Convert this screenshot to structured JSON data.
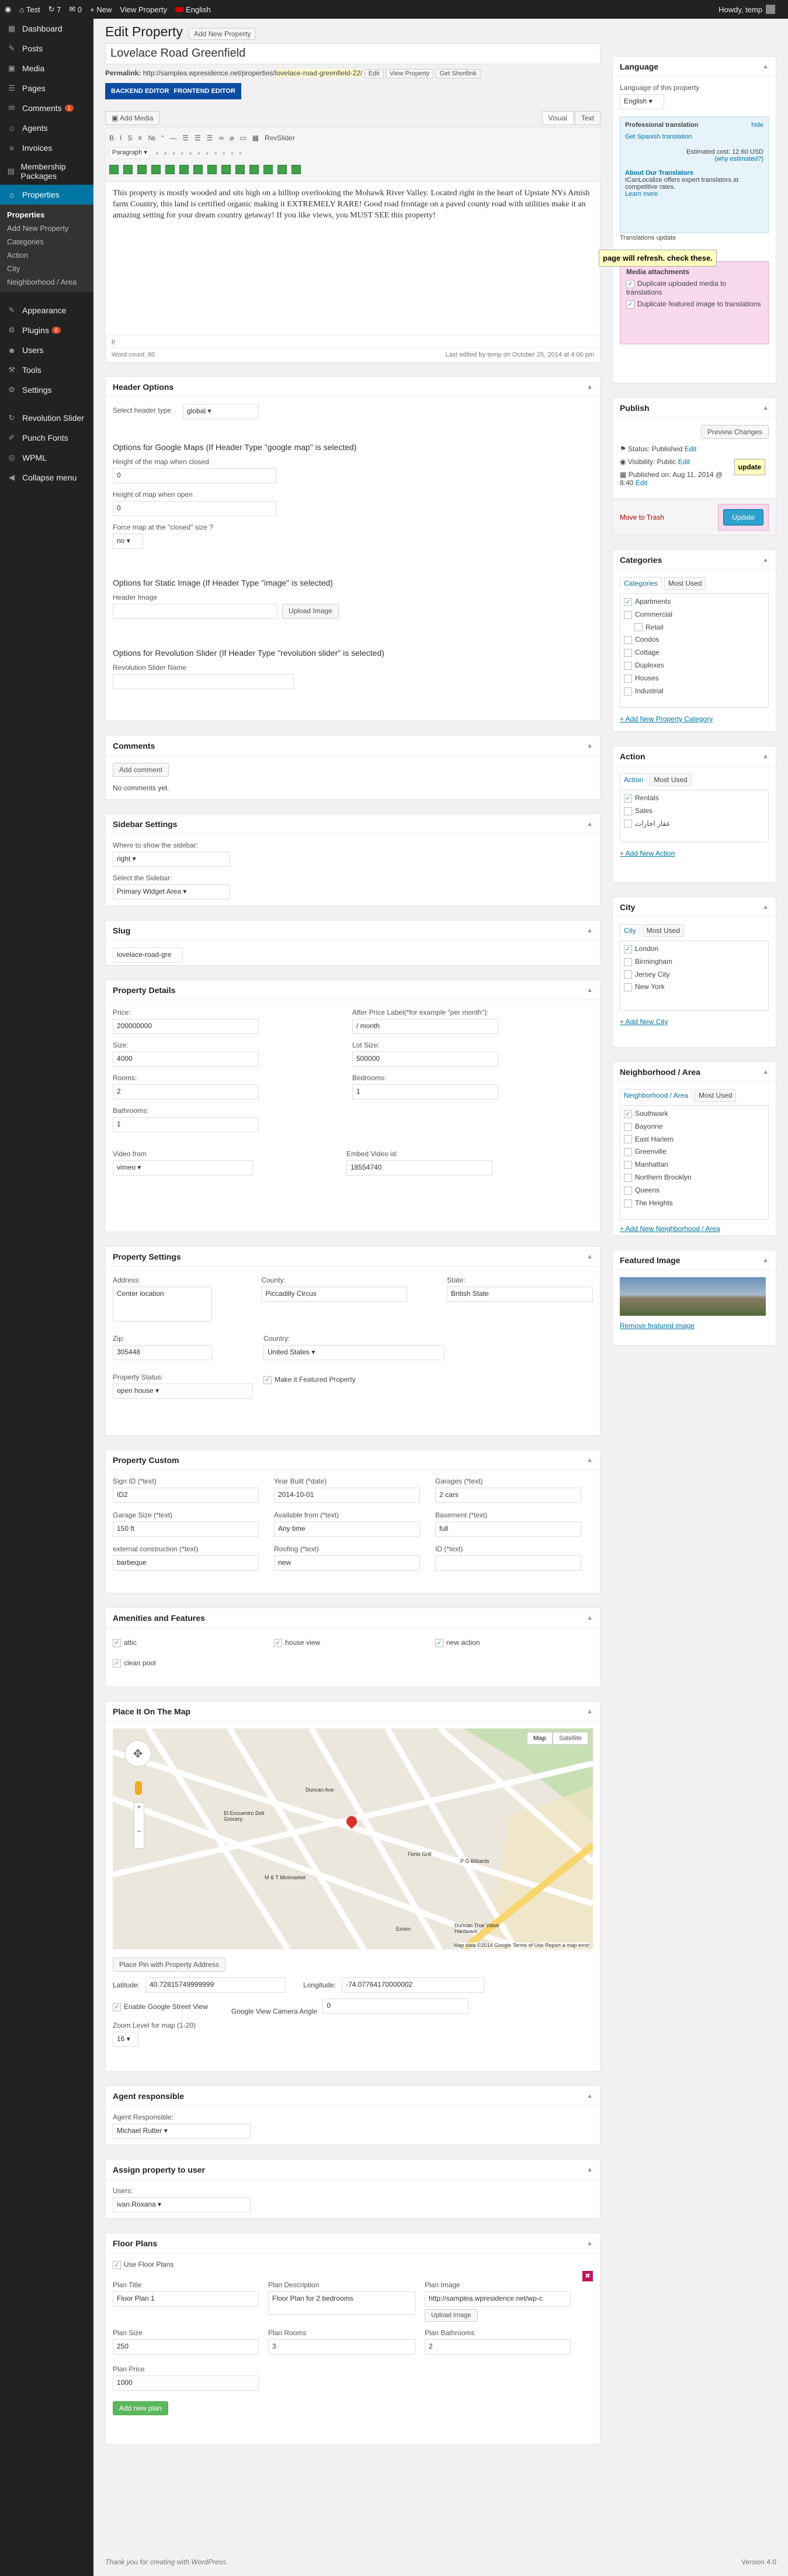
{
  "adminbar": {
    "site": "Test",
    "updates": "7",
    "comments": "0",
    "new": "New",
    "view": "View Property",
    "lang": "English",
    "howdy": "Howdy, temp"
  },
  "sidebar": {
    "items": [
      {
        "label": "Dashboard",
        "icon": "dashboard-icon"
      },
      {
        "label": "Posts",
        "icon": "pin-icon"
      },
      {
        "label": "Media",
        "icon": "media-icon"
      },
      {
        "label": "Pages",
        "icon": "page-icon"
      },
      {
        "label": "Comments",
        "icon": "comment-icon",
        "badge": "1"
      },
      {
        "label": "Agents",
        "icon": "agents-icon"
      },
      {
        "label": "Invoices",
        "icon": "invoice-icon"
      },
      {
        "label": "Membership Packages",
        "icon": "package-icon"
      },
      {
        "label": "Properties",
        "icon": "properties-icon",
        "active": true
      }
    ],
    "submenu": [
      "Properties",
      "Add New Property",
      "Categories",
      "Action",
      "City",
      "Neighborhood / Area"
    ],
    "items2": [
      {
        "label": "Appearance",
        "icon": "brush-icon"
      },
      {
        "label": "Plugins",
        "icon": "plugin-icon",
        "badge": "6"
      },
      {
        "label": "Users",
        "icon": "users-icon"
      },
      {
        "label": "Tools",
        "icon": "tools-icon"
      },
      {
        "label": "Settings",
        "icon": "settings-icon"
      }
    ],
    "items3": [
      {
        "label": "Revolution Slider",
        "icon": "slider-icon"
      },
      {
        "label": "Punch Fonts",
        "icon": "fonts-icon"
      },
      {
        "label": "WPML",
        "icon": "wpml-icon"
      },
      {
        "label": "Collapse menu",
        "icon": "collapse-icon"
      }
    ]
  },
  "header": {
    "title": "Edit Property",
    "add_new": "Add New Property"
  },
  "post": {
    "title": "Lovelace Road Greenfield",
    "permalink_label": "Permalink:",
    "permalink_base": "http://samplea.wpresidence.net/properties/",
    "permalink_slug": "lovelace-road-greenfield-22/",
    "edit": "Edit",
    "view": "View Property",
    "shortlink": "Get Shortlink",
    "backend_editor": "BACKEND EDITOR",
    "frontend_editor": "FRONTEND EDITOR",
    "add_media": "Add Media",
    "visual": "Visual",
    "text": "Text",
    "format": "Paragraph",
    "revslider": "RevSlider",
    "content": "This property is mostly wooded and sits high on a hilltop overlooking the Mohawk River Valley. Located right in the heart of Upstate NYs Amish farm Country, this land is certified organic making it EXTREMELY RARE! Good road frontage on a paved county road with utilities make it an amazing setting for your dream country getaway! If you like views, you MUST SEE this property!",
    "path": "p",
    "word_count": "Word count: 80",
    "last_edited": "Last edited by temp on October 25, 2014 at 4:00 pm"
  },
  "header_options": {
    "title": "Header Options",
    "type_label": "Select header type",
    "type_value": "global",
    "gmaps_title": "Options for Google Maps (If Header Type \"google map\" is selected)",
    "closed_label": "Height of the map when closed",
    "closed_value": "0",
    "open_label": "Height of map when open",
    "open_value": "0",
    "force_label": "Force map at the \"closed\" size ?",
    "force_value": "no",
    "image_title": "Options for Static Image (If Header Type \"image\" is selected)",
    "image_label": "Header Image",
    "upload": "Upload Image",
    "rev_title": "Options for Revolution Slider (If Header Type \"revolution slider\" is selected)",
    "rev_label": "Revolution Slider Name"
  },
  "comments": {
    "title": "Comments",
    "add": "Add comment",
    "none": "No comments yet."
  },
  "sidebar_settings": {
    "title": "Sidebar Settings",
    "where_label": "Where to show the sidebar:",
    "where_value": "right",
    "select_label": "Select the Sidebar:",
    "select_value": "Primary Widget Area"
  },
  "slug": {
    "title": "Slug",
    "value": "lovelace-road-gre"
  },
  "details": {
    "title": "Property Details",
    "price_label": "Price:",
    "price": "200000000",
    "after_label": "After Price Label(*for example \"per month\"):",
    "after": "/ month",
    "size_label": "Size:",
    "size": "4000",
    "lot_label": "Lot Size:",
    "lot": "500000",
    "rooms_label": "Rooms:",
    "rooms": "2",
    "bed_label": "Bedrooms:",
    "bed": "1",
    "bath_label": "Bathrooms:",
    "bath": "1",
    "video_label": "Video from",
    "video": "vimeo",
    "embed_label": "Embed Video id:",
    "embed": "18554740"
  },
  "settings": {
    "title": "Property Settings",
    "addr_label": "Address:",
    "addr": "Center location",
    "county_label": "County:",
    "county": "Piccadilly Circus",
    "state_label": "State:",
    "state": "British State",
    "zip_label": "Zip:",
    "zip": "305448",
    "country_label": "Country:",
    "country": "United States",
    "status_label": "Property Status:",
    "status": "open house",
    "featured": "Make it Featured Property"
  },
  "custom": {
    "title": "Property Custom",
    "fields": [
      {
        "label": "Sign ID (*text)",
        "value": "ID2"
      },
      {
        "label": "Year Built (*date)",
        "value": "2014-10-01"
      },
      {
        "label": "Garages (*text)",
        "value": "2 cars"
      },
      {
        "label": "Garage Size (*text)",
        "value": "150 ft"
      },
      {
        "label": "Available from (*text)",
        "value": "Any time"
      },
      {
        "label": "Basement (*text)",
        "value": "full"
      },
      {
        "label": "external construction (*text)",
        "value": "barbeque"
      },
      {
        "label": "Roofing (*text)",
        "value": "new"
      },
      {
        "label": "ID (*text)",
        "value": ""
      }
    ]
  },
  "amenities": {
    "title": "Amenities and Features",
    "items": [
      "attic",
      "house view",
      "new action",
      "clean pool"
    ]
  },
  "map": {
    "title": "Place It On The Map",
    "map_btn": "Map",
    "sat_btn": "Satellite",
    "place_btn": "Place Pin with Property Address",
    "lat_label": "Latitude:",
    "lat": "40.72815749999999",
    "lng_label": "Longitude:",
    "lng": "-74.07764170000002",
    "streetview": "Enable Google Street View",
    "angle_label": "Google View Camera Angle",
    "angle": "0",
    "zoom_label": "Zoom Level for map (1-20)",
    "zoom": "16",
    "credit": "Map data ©2014 Google   Terms of Use   Report a map error",
    "labels": [
      "El Encuentro Deli Grocery",
      "Fenix Grill",
      "P G Billiards",
      "M & T Minimarket",
      "Essen",
      "Duncan Ave",
      "Duncan True Value Hardware"
    ]
  },
  "agent": {
    "title": "Agent responsible",
    "label": "Agent Responsible:",
    "value": "Michael Rutter"
  },
  "assign": {
    "title": "Assign property to user",
    "label": "Users:",
    "value": "ivan.Roxana"
  },
  "floor": {
    "title": "Floor Plans",
    "use": "Use Floor Plans",
    "plan_title_label": "Plan Title",
    "plan_title": "Floor Plan 1",
    "desc_label": "Plan Description",
    "desc": "Floor Plan for 2 bedrooms",
    "image_label": "Plan Image",
    "image": "http://samplea.wpresidence.net/wp-c",
    "upload": "Upload Image",
    "size_label": "Plan Size",
    "size": "250",
    "rooms_label": "Plan Rooms",
    "rooms": "3",
    "bath_label": "Plan Bathrooms",
    "bath": "2",
    "price_label": "Plan Price",
    "price": "1000",
    "add": "Add new plan"
  },
  "footer": {
    "thanks": "Thank you for creating with WordPress.",
    "version": "Version 4.0"
  },
  "language": {
    "title": "Language",
    "label": "Language of this property",
    "value": "English",
    "pro_title": "Professional translation",
    "hide": "hide",
    "get_link": "Get Spanish translation",
    "cost": "Estimated cost: 12.60 USD",
    "why": "(why estimated?)",
    "about_title": "About Our Translators",
    "about_text": "ICanLocalize offers expert translators at competitive rates.",
    "learn": "Learn more",
    "tip": "page will refresh. check these.",
    "media_title": "Media attachments",
    "media1": "Duplicate uploaded media to translations",
    "media2": "Duplicate featured image to translations",
    "trans_update": "Translations update"
  },
  "publish": {
    "title": "Publish",
    "preview": "Preview Changes",
    "status": "Status: Published",
    "status_edit": "Edit",
    "visibility": "Visibility: Public",
    "vis_edit": "Edit",
    "published": "Published on: Aug 11, 2014 @ 8:40",
    "pub_edit": "Edit",
    "trash": "Move to Trash",
    "update": "Update",
    "tip": "update"
  },
  "categories": {
    "title": "Categories",
    "tab1": "Categories",
    "tab2": "Most Used",
    "items": [
      {
        "label": "Apartments",
        "checked": true
      },
      {
        "label": "Commercial"
      },
      {
        "label": "Retail",
        "indent": true
      },
      {
        "label": "Condos"
      },
      {
        "label": "Cottage"
      },
      {
        "label": "Duplexes"
      },
      {
        "label": "Houses"
      },
      {
        "label": "Industrial"
      }
    ],
    "add": "+ Add New Property Category"
  },
  "action": {
    "title": "Action",
    "tab1": "Action",
    "tab2": "Most Used",
    "items": [
      {
        "label": "Rentals",
        "checked": true
      },
      {
        "label": "Sales"
      },
      {
        "label": "عقار اجارات"
      }
    ],
    "add": "+ Add New Action"
  },
  "city": {
    "title": "City",
    "tab1": "City",
    "tab2": "Most Used",
    "items": [
      {
        "label": "London",
        "checked": true
      },
      {
        "label": "Birmingham"
      },
      {
        "label": "Jersey City"
      },
      {
        "label": "New York"
      }
    ],
    "add": "+ Add New City"
  },
  "neighborhood": {
    "title": "Neighborhood / Area",
    "tab1": "Neighborhood / Area",
    "tab2": "Most Used",
    "items": [
      {
        "label": "Southwark",
        "checked": true
      },
      {
        "label": "Bayonne"
      },
      {
        "label": "East Harlem"
      },
      {
        "label": "Greenville"
      },
      {
        "label": "Manhattan"
      },
      {
        "label": "Northern Brooklyn"
      },
      {
        "label": "Queens"
      },
      {
        "label": "The Heights"
      }
    ],
    "add": "+ Add New Neighborhood / Area"
  },
  "featured": {
    "title": "Featured Image",
    "remove": "Remove featured image"
  },
  "colors": {
    "accent": "#0074a2",
    "admin_bg": "#222222",
    "tip_bg": "#ffffc0",
    "pink": "#f9d9ee"
  }
}
